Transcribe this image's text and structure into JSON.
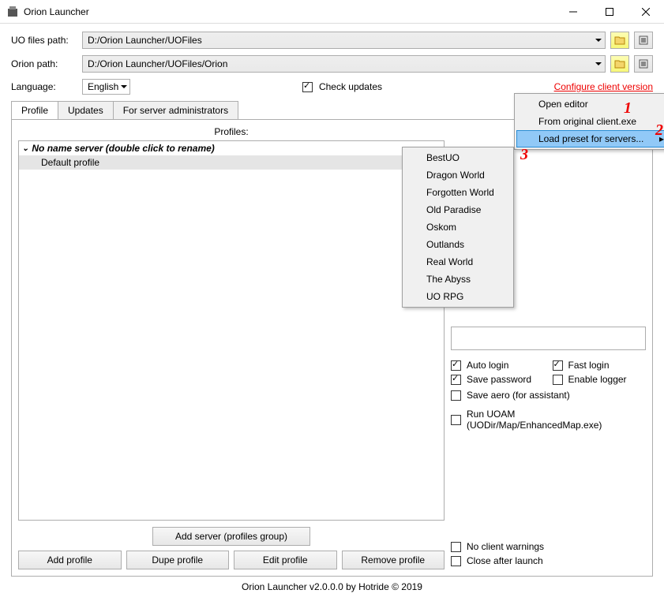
{
  "window": {
    "title": "Orion Launcher"
  },
  "paths": {
    "uo_label": "UO files path:",
    "uo_value": "D:/Orion Launcher/UOFiles",
    "orion_label": "Orion path:",
    "orion_value": "D:/Orion Launcher/UOFiles/Orion"
  },
  "language": {
    "label": "Language:",
    "value": "English"
  },
  "check_updates_label": "Check updates",
  "configure_link": "Configure client version",
  "tabs": {
    "profile": "Profile",
    "updates": "Updates",
    "admins": "For server administrators"
  },
  "profiles_heading": "Profiles:",
  "tree": {
    "server_header": "No name server (double click to rename)",
    "default_profile": "Default profile"
  },
  "buttons": {
    "add_server": "Add server (profiles group)",
    "add_profile": "Add profile",
    "dupe_profile": "Dupe profile",
    "edit_profile": "Edit profile",
    "remove_profile": "Remove profile"
  },
  "right_checks": {
    "auto_login": "Auto login",
    "fast_login": "Fast login",
    "save_password": "Save password",
    "enable_logger": "Enable logger",
    "save_aero": "Save aero (for assistant)",
    "run_uoam": "Run UOAM (UODir/Map/EnhancedMap.exe)",
    "no_client_warnings": "No client warnings",
    "close_after_launch": "Close after launch"
  },
  "context_menu": {
    "open_editor": "Open editor",
    "from_original": "From original client.exe",
    "load_preset": "Load preset for servers..."
  },
  "annotations": {
    "a1": "1",
    "a2": "2",
    "a3": "3"
  },
  "server_presets": [
    "BestUO",
    "Dragon World",
    "Forgotten World",
    "Old Paradise",
    "Oskom",
    "Outlands",
    "Real World",
    "The Abyss",
    "UO RPG"
  ],
  "footer": "Orion Launcher v2.0.0.0 by Hotride © 2019"
}
